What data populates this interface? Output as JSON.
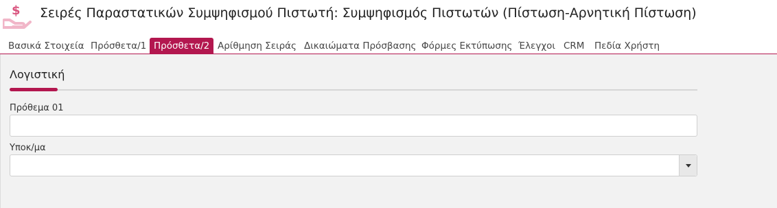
{
  "header": {
    "icon": "money-hand-icon",
    "title": "Σειρές Παραστατικών Συμψηφισμού Πιστωτή: Συμψηφισμός Πιστωτών (Πίστωση-Αρνητική Πίστωση)"
  },
  "tabs": [
    {
      "label": "Βασικά Στοιχεία",
      "active": false
    },
    {
      "label": "Πρόσθετα/1",
      "active": false
    },
    {
      "label": "Πρόσθετα/2",
      "active": true
    },
    {
      "label": "Αρίθμηση Σειράς",
      "active": false
    },
    {
      "label": "Δικαιώματα Πρόσβασης",
      "active": false
    },
    {
      "label": "Φόρμες Εκτύπωσης",
      "active": false
    },
    {
      "label": "Έλεγχοι",
      "active": false
    },
    {
      "label": "CRM",
      "active": false
    },
    {
      "label": "Πεδία Χρήστη",
      "active": false
    }
  ],
  "section": {
    "title": "Λογιστική"
  },
  "fields": {
    "prefix": {
      "label": "Πρόθεμα 01",
      "value": ""
    },
    "branch": {
      "label": "Υποκ/μα",
      "value": ""
    }
  },
  "colors": {
    "accent": "#b3174f",
    "icon": "#d9557f",
    "background": "#f2f2f2"
  }
}
